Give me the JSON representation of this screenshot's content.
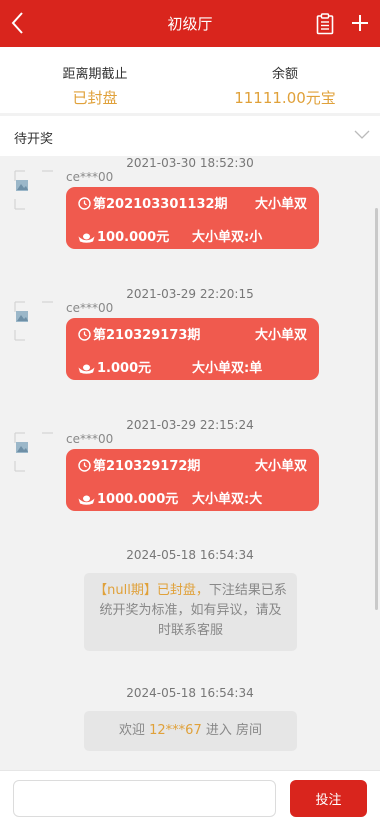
{
  "header": {
    "title": "初级厅",
    "back_icon": "chevron-left-icon",
    "doc_icon": "clipboard-icon",
    "add_icon": "plus-icon"
  },
  "info": {
    "countdown_label": "距离期截止",
    "countdown_value": "已封盘",
    "balance_label": "余额",
    "balance_value": "11111.00元宝",
    "value_color": "#e0a13a"
  },
  "pending": {
    "label": "待开奖",
    "icon": "chevron-down-icon"
  },
  "bets": [
    {
      "time": "2021-03-30 18:52:30",
      "user": "ce***00",
      "period": "第202103301132期",
      "type": "大小单双",
      "amount": "100.000元",
      "pick": "大小单双:小"
    },
    {
      "time": "2021-03-29 22:20:15",
      "user": "ce***00",
      "period": "第210329173期",
      "type": "大小单双",
      "amount": "1.000元",
      "pick": "大小单双:单"
    },
    {
      "time": "2021-03-29 22:15:24",
      "user": "ce***00",
      "period": "第210329172期",
      "type": "大小单双",
      "amount": "1000.000元",
      "pick": "大小单双:大"
    }
  ],
  "system": {
    "time": "2024-05-18 16:54:34",
    "highlight": "【null期】已封盘，",
    "text": "下注结果已系统开奖为标准，如有异议，请及时联系客服"
  },
  "welcome": {
    "time": "2024-05-18 16:54:34",
    "prefix": "欢迎",
    "user": "12***67",
    "suffix": "进入 房间"
  },
  "footer": {
    "input_placeholder": "",
    "button_label": "投注"
  },
  "colors": {
    "brand": "#d9251d",
    "card": "#f05a4e",
    "accent": "#e0a13a"
  }
}
